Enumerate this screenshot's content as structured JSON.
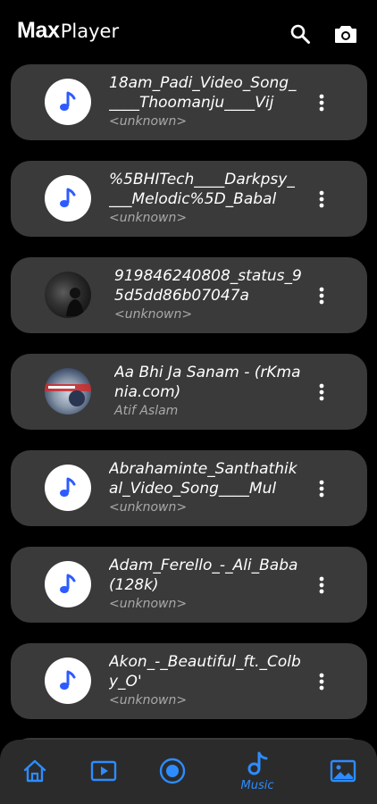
{
  "app": {
    "brand_bold": "Max",
    "brand_light": "Player"
  },
  "header": {
    "icons": [
      "search-icon",
      "camera-icon"
    ]
  },
  "songs": [
    {
      "title": "18am_Padi_Video_Song_____Thoomanju____Vij",
      "subtitle": "<unknown>",
      "thumb": "music-note-icon"
    },
    {
      "title": "%5BHITech____Darkpsy____Melodic%5D_Babal",
      "subtitle": "<unknown>",
      "thumb": "music-note-icon"
    },
    {
      "title": "919846240808_status_95d5dd86b07047a",
      "subtitle": "<unknown>",
      "thumb": "photo"
    },
    {
      "title": "Aa Bhi Ja Sanam - (rKmania.com)",
      "subtitle": "Atif Aslam",
      "thumb": "album-art"
    },
    {
      "title": "Abrahaminte_Santhathikal_Video_Song____Mul",
      "subtitle": "<unknown>",
      "thumb": "music-note-icon"
    },
    {
      "title": "Adam_Ferello_-_Ali_Baba(128k)",
      "subtitle": "<unknown>",
      "thumb": "music-note-icon"
    },
    {
      "title": "Akon_-_Beautiful_ft._Colby_O'",
      "subtitle": "<unknown>",
      "thumb": "music-note-icon"
    }
  ],
  "bottom_nav": {
    "items": [
      {
        "icon": "home-icon",
        "label": ""
      },
      {
        "icon": "video-icon",
        "label": ""
      },
      {
        "icon": "record-icon",
        "label": ""
      },
      {
        "icon": "music-icon",
        "label": "Music",
        "active": true
      },
      {
        "icon": "image-icon",
        "label": ""
      }
    ]
  },
  "colors": {
    "background": "#000000",
    "card": "#3a3a3a",
    "accent": "#2d8cff",
    "subtitle": "#a9a9a9",
    "nav_bg": "#2b2b2b"
  }
}
